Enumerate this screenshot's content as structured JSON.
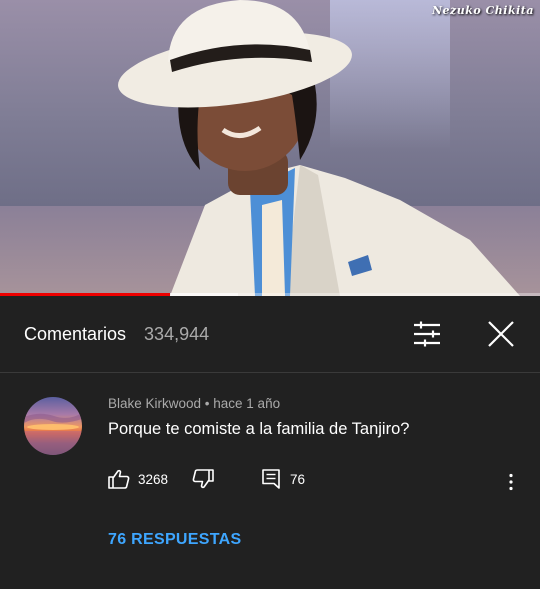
{
  "video": {
    "watermark": "Nezuko Chikita",
    "progress": 0.315,
    "buffered": 0.44
  },
  "comments_header": {
    "title": "Comentarios",
    "count": "334,944",
    "filter_icon": "sliders-icon",
    "close_icon": "close-icon"
  },
  "comment": {
    "author_meta": "Blake Kirkwood • hace 1 año",
    "text": "Porque te comiste a la familia de Tanjiro?",
    "likes": "3268",
    "replies_count": "76",
    "replies_link": "76 RESPUESTAS",
    "icons": {
      "like": "thumbs-up-icon",
      "dislike": "thumbs-down-icon",
      "reply": "reply-icon",
      "more": "more-vert-icon"
    }
  },
  "colors": {
    "background": "#212121",
    "accent_link": "#3ea6ff",
    "progress": "#ee0000",
    "secondary_text": "#aaaaaa"
  }
}
